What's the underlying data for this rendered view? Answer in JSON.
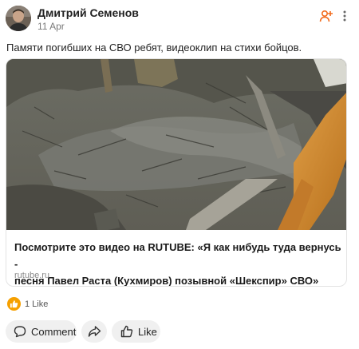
{
  "post": {
    "author": "Дмитрий Семенов",
    "date": "11 Apr",
    "text": "Памяти погибших на СВО ребят, видеоклип на стихи бойцов."
  },
  "header_icons": [
    "add-friend-icon",
    "more-vertical-icon"
  ],
  "link_card": {
    "title_line1": "Посмотрите это видео на RUTUBE: «Я как нибудь туда вернусь -",
    "title_line2": "песня Павел Раста (Кухмиров) позывной «Шекспир» СВО»",
    "domain": "rutube.ru"
  },
  "reactions": {
    "likes_count": "1 Like",
    "badge_icon": "thumbs-up-icon",
    "badge_color": "#f6a000"
  },
  "actions": {
    "comment_label": "Comment",
    "share_icon": "share-icon",
    "like_label": "Like"
  },
  "colors": {
    "accent_orange": "#f26b1d",
    "button_bg": "#f0f0f0"
  }
}
